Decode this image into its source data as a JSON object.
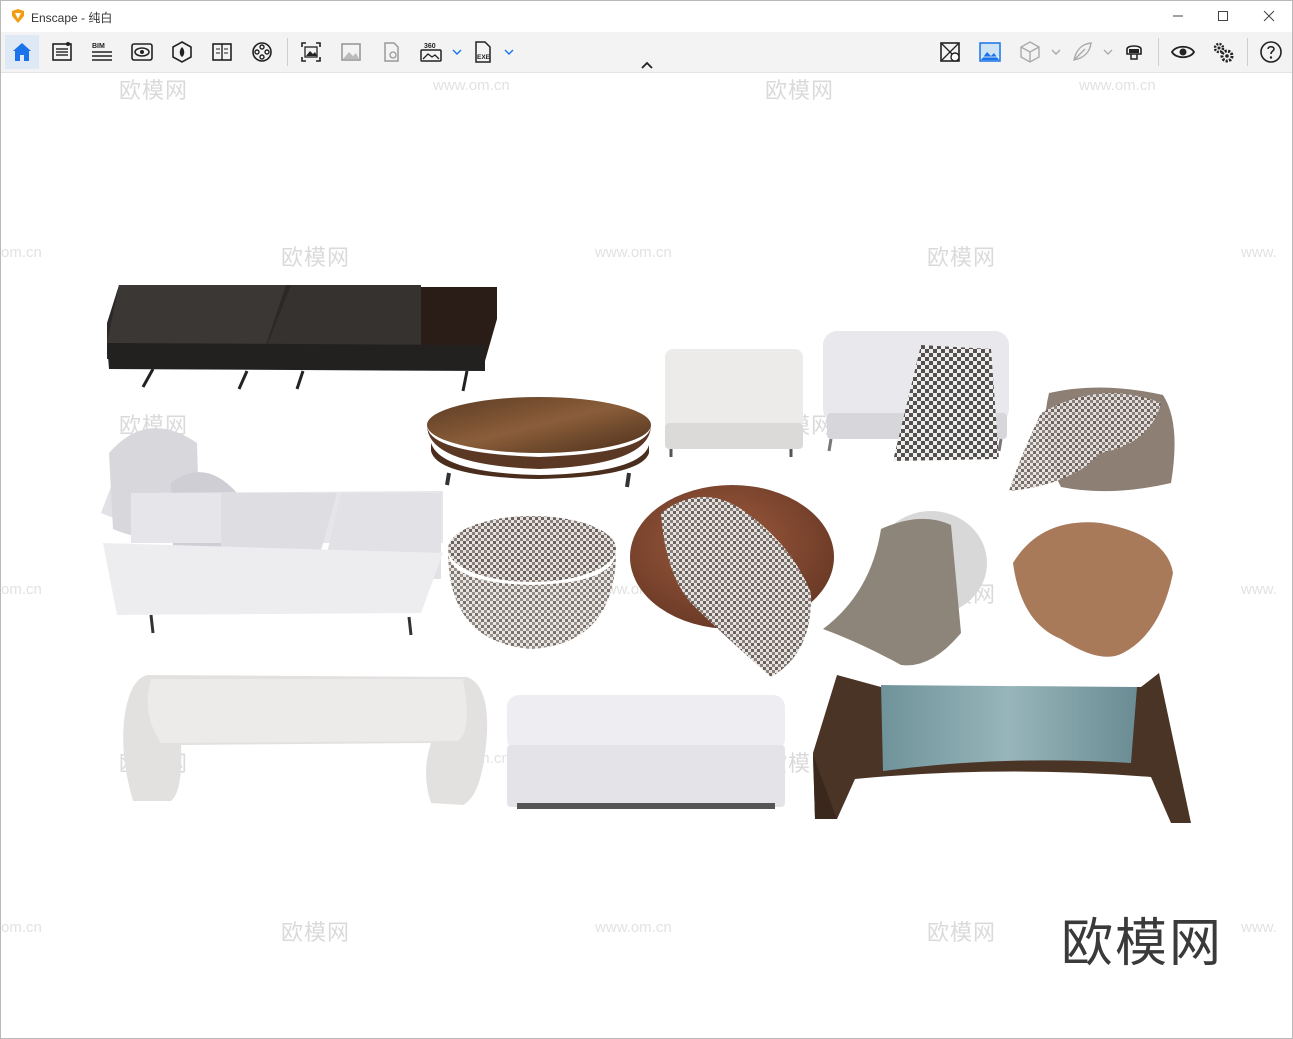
{
  "window": {
    "title": "Enscape - 纯白"
  },
  "titlebar": {
    "minimize_icon": "minimize-icon",
    "maximize_icon": "maximize-icon",
    "close_icon": "close-icon"
  },
  "toolbar": {
    "left_icons": [
      "home-icon",
      "settings-list-icon",
      "bim-icon",
      "view-icon",
      "asset-library-icon",
      "views-manager-icon",
      "video-editor-icon",
      "screenshot-icon",
      "batch-render-icon",
      "render-settings-icon",
      "panorama-360-icon",
      "export-exe-icon"
    ],
    "bim_label": "BIM",
    "pano_label": "360",
    "exe_label": "EXE",
    "right_icons": [
      "material-editor-icon",
      "landscape-icon",
      "cube-icon",
      "feather-icon",
      "vr-headset-icon",
      "eye-icon",
      "gears-icon",
      "help-icon"
    ]
  },
  "watermarks": {
    "brand": "欧模网",
    "url": "www.om.cn",
    "url_partial_left": "om.cn",
    "url_partial_right": "www.",
    "big_logo": "欧模网"
  },
  "colors": {
    "accent": "#1a73e8",
    "toolbar_bg": "#f3f3f3",
    "logo_orange": "#f39c12"
  }
}
